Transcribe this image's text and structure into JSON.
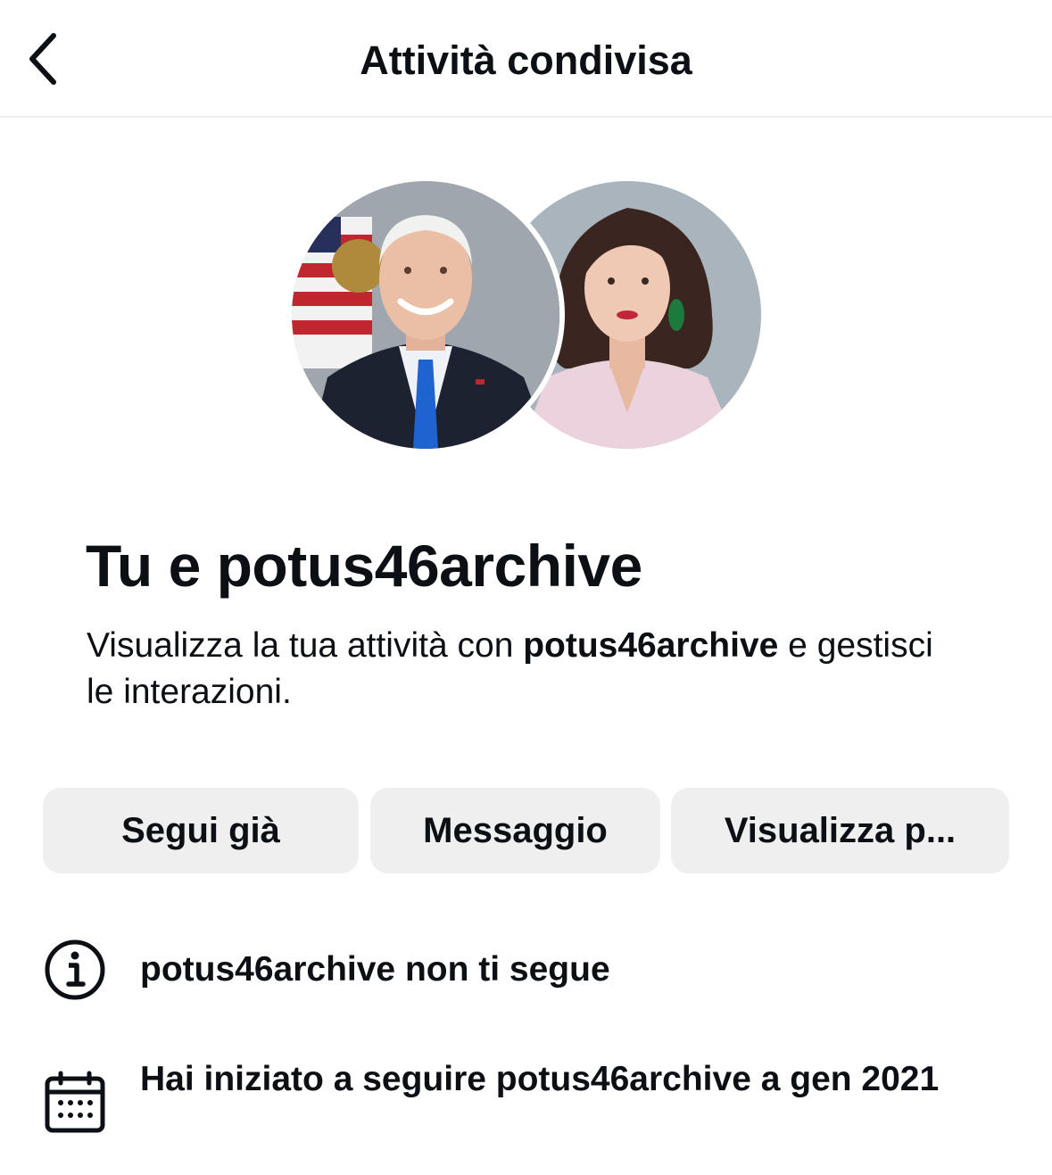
{
  "header": {
    "title": "Attività condivisa",
    "back_icon": "chevron-left-icon"
  },
  "avatars": {
    "left": "profile-photo-potus46archive",
    "right": "profile-photo-user"
  },
  "main": {
    "title": "Tu e potus46archive",
    "description_prefix": "Visualizza la tua attività con ",
    "description_username": "potus46archive",
    "description_suffix": " e gestisci le interazioni."
  },
  "actions": {
    "follow_label": "Segui già",
    "message_label": "Messaggio",
    "view_profile_label": "Visualizza p..."
  },
  "info": {
    "not_following": {
      "icon": "info-icon",
      "text": "potus46archive non ti segue"
    },
    "following_since": {
      "icon": "calendar-icon",
      "text": "Hai iniziato a seguire potus46archive a gen 2021"
    }
  },
  "colors": {
    "text": "#0c1014",
    "button_bg": "#efefef",
    "divider": "#efefef"
  }
}
